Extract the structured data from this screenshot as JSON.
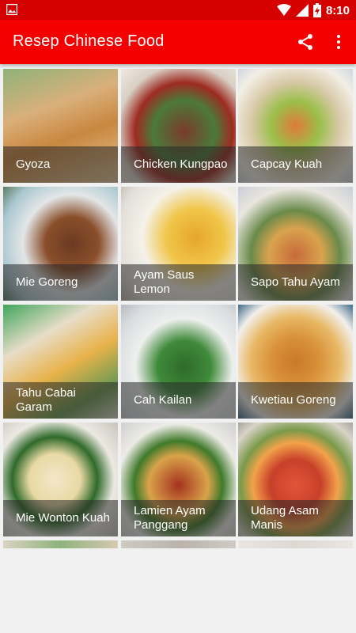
{
  "status_bar": {
    "time": "8:10",
    "icons": [
      "image-notification-icon",
      "wifi-icon",
      "signal-icon",
      "battery-charging-icon"
    ]
  },
  "app_bar": {
    "title": "Resep Chinese Food",
    "actions": [
      "share-icon",
      "more-vert-icon"
    ]
  },
  "colors": {
    "status_bar": "#d50000",
    "app_bar": "#f40000",
    "background": "#f1f1f1"
  },
  "recipes": [
    {
      "label": "Gyoza"
    },
    {
      "label": "Chicken Kungpao"
    },
    {
      "label": "Capcay Kuah"
    },
    {
      "label": "Mie Goreng"
    },
    {
      "label": "Ayam Saus Lemon"
    },
    {
      "label": "Sapo Tahu Ayam"
    },
    {
      "label": "Tahu Cabai Garam"
    },
    {
      "label": "Cah Kailan"
    },
    {
      "label": "Kwetiau Goreng"
    },
    {
      "label": "Mie Wonton Kuah"
    },
    {
      "label": "Lamien Ayam Panggang"
    },
    {
      "label": "Udang Asam Manis"
    }
  ]
}
